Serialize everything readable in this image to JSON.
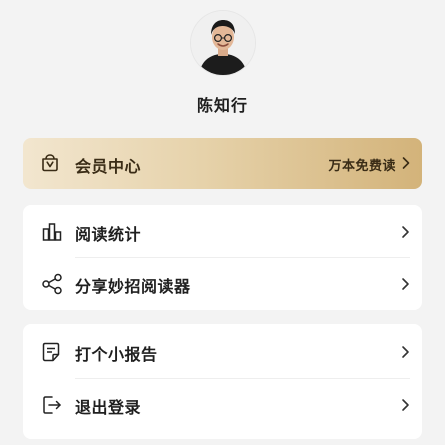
{
  "profile": {
    "name": "陈知行",
    "avatar_icon": "person-avatar"
  },
  "vip": {
    "icon": "membership-bag-icon",
    "label": "会员中心",
    "promo": "万本免费读"
  },
  "menu_group_1": [
    {
      "label": "阅读统计",
      "icon": "bar-chart-icon"
    },
    {
      "label": "分享妙招阅读器",
      "icon": "share-icon"
    }
  ],
  "menu_group_2": [
    {
      "label": "打个小报告",
      "icon": "report-document-icon"
    },
    {
      "label": "退出登录",
      "icon": "logout-icon"
    }
  ],
  "colors": {
    "background": "#f3f3f3",
    "card": "#ffffff",
    "vip_gradient_start": "#f2e6cf",
    "vip_gradient_end": "#d3b37a",
    "vip_text": "#3a2c16",
    "text_primary": "#1f1f1f"
  }
}
